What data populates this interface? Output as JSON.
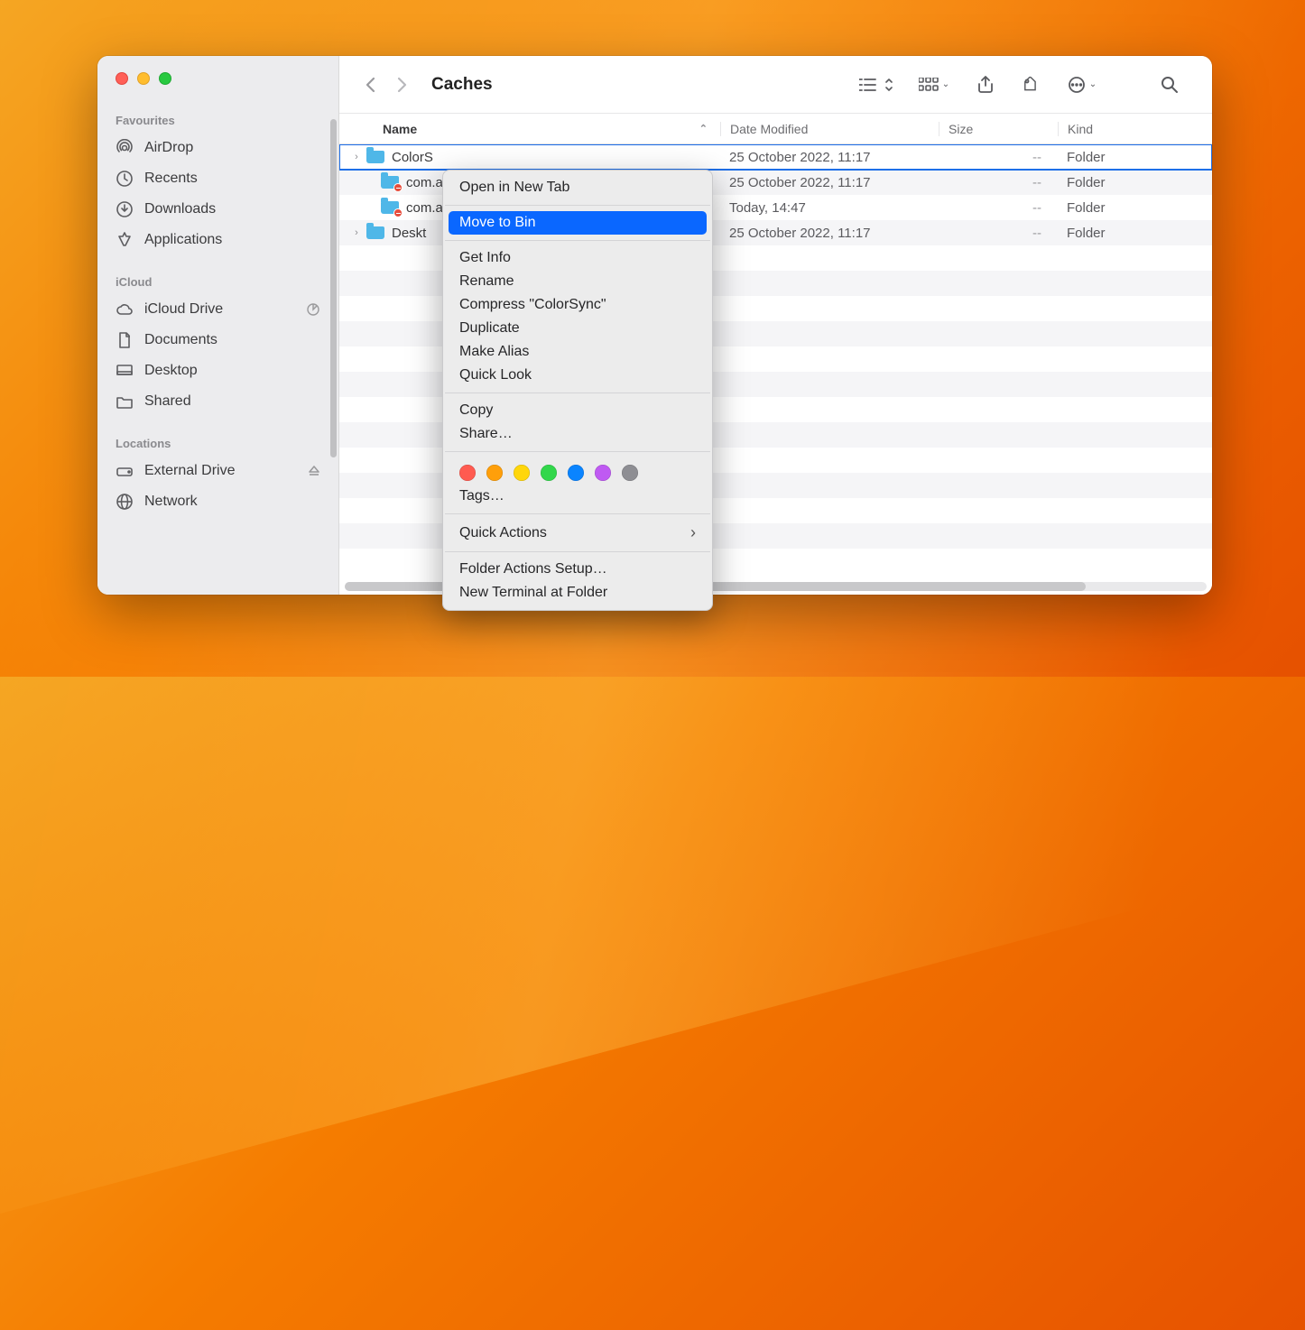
{
  "window": {
    "title": "Caches"
  },
  "sidebar": {
    "sections": [
      {
        "heading": "Favourites",
        "items": [
          {
            "icon": "airdrop",
            "label": "AirDrop"
          },
          {
            "icon": "clock",
            "label": "Recents"
          },
          {
            "icon": "download",
            "label": "Downloads"
          },
          {
            "icon": "apps",
            "label": "Applications"
          }
        ]
      },
      {
        "heading": "iCloud",
        "items": [
          {
            "icon": "cloud",
            "label": "iCloud Drive",
            "tail_icon": "pie"
          },
          {
            "icon": "document",
            "label": "Documents"
          },
          {
            "icon": "desktop",
            "label": "Desktop"
          },
          {
            "icon": "sharedfolder",
            "label": "Shared"
          }
        ]
      },
      {
        "heading": "Locations",
        "items": [
          {
            "icon": "drive",
            "label": "External Drive",
            "tail_icon": "eject"
          },
          {
            "icon": "globe",
            "label": "Network"
          }
        ]
      }
    ]
  },
  "columns": {
    "name": "Name",
    "date": "Date Modified",
    "size": "Size",
    "kind": "Kind"
  },
  "rows": [
    {
      "disclosure": true,
      "indent": 0,
      "badge": false,
      "selected": true,
      "name": "ColorSync",
      "date": "25 October 2022, 11:17",
      "size": "--",
      "kind": "Folder",
      "name_truncated": "ColorS"
    },
    {
      "disclosure": false,
      "indent": 1,
      "badge": true,
      "selected": false,
      "name": "com.a",
      "date": "25 October 2022, 11:17",
      "size": "--",
      "kind": "Folder",
      "name_truncated": "com.a"
    },
    {
      "disclosure": false,
      "indent": 1,
      "badge": true,
      "selected": false,
      "name": "com.a",
      "date": "Today, 14:47",
      "size": "--",
      "kind": "Folder",
      "name_truncated": "com.a"
    },
    {
      "disclosure": true,
      "indent": 0,
      "badge": false,
      "selected": false,
      "name": "Desktop",
      "date": "25 October 2022, 11:17",
      "size": "--",
      "kind": "Folder",
      "name_truncated": "Deskt"
    }
  ],
  "context_menu": {
    "groups": [
      [
        "Open in New Tab"
      ],
      [
        "Move to Bin"
      ],
      [
        "Get Info",
        "Rename",
        "Compress \"ColorSync\"",
        "Duplicate",
        "Make Alias",
        "Quick Look"
      ],
      [
        "Copy",
        "Share…"
      ],
      "TAGS",
      [
        "Tags…"
      ],
      [
        {
          "label": "Quick Actions",
          "submenu": true
        }
      ],
      [
        "Folder Actions Setup…",
        "New Terminal at Folder"
      ]
    ],
    "highlighted": "Move to Bin",
    "tag_colors": [
      "#ff5b50",
      "#ff9f0a",
      "#ffd60a",
      "#32d74b",
      "#0a84ff",
      "#bf5af2",
      "#8e8e93"
    ]
  }
}
